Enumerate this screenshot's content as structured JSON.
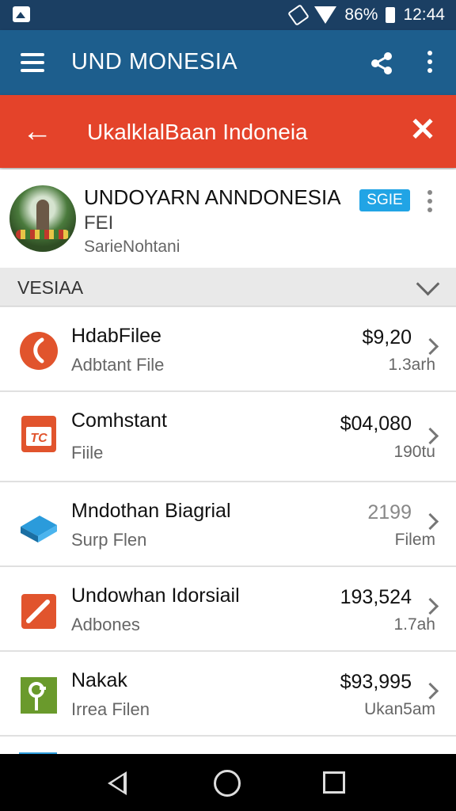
{
  "status_bar": {
    "battery": "86%",
    "time": "12:44"
  },
  "app_bar": {
    "title": "UND MONESIA",
    "icons": [
      "menu-icon",
      "share-icon",
      "more-icon"
    ]
  },
  "header": {
    "title": "UkalklalBaan Indoneia",
    "icons": [
      "back-icon",
      "close-icon"
    ]
  },
  "profile": {
    "name": "UNDOYARN ANNDONESIA",
    "subtitle": "FEI",
    "caption": "SarieNohtani",
    "badge": "SGIE"
  },
  "section": {
    "label": "VESIAA"
  },
  "items": [
    {
      "title": "HdabFilee",
      "subtitle": "Adbtant File",
      "value": "$9,20",
      "meta": "1.3arh"
    },
    {
      "title": "Comhstant",
      "subtitle": "Fiile",
      "value": "$04,080",
      "meta": "190tu"
    },
    {
      "title": "Mndothan Biagrial",
      "subtitle": "Surp Flen",
      "value": "2199",
      "meta": "Filem"
    },
    {
      "title": "Undowhan Idorsiail",
      "subtitle": "Adbones",
      "value": "193,524",
      "meta": "1.7ah"
    },
    {
      "title": "Nakak",
      "subtitle": "Irrea Filen",
      "value": "$93,995",
      "meta": "Ukan5am"
    }
  ],
  "colors": {
    "status_bar": "#1b3f63",
    "app_bar": "#1d5e8d",
    "header": "#e4432a",
    "badge": "#21a4e5"
  }
}
